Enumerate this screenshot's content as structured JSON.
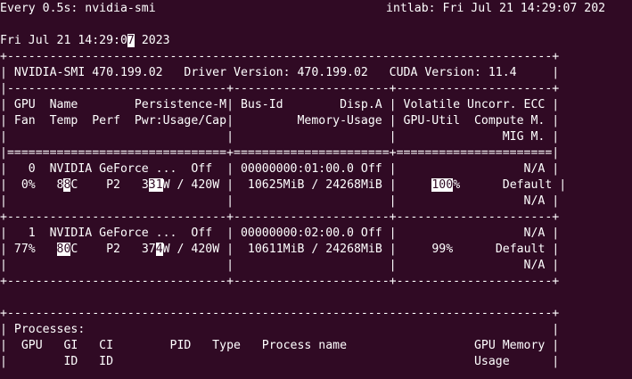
{
  "watch_header": {
    "command": "Every 0.5s: nvidia-smi",
    "host_time": "intlab: Fri Jul 21 14:29:07 202"
  },
  "date_line": {
    "before_cursor": "Fri Jul 21 14:29:0",
    "cursor_char": "7",
    "after_cursor": " 2023"
  },
  "smi_table": {
    "border_top": "+-----------------------------------------------------------------------------+",
    "version_row": "| NVIDIA-SMI 470.199.02   Driver Version: 470.199.02   CUDA Version: 11.4     |",
    "section_sep": "|-------------------------------+----------------------+----------------------+",
    "header_row_1": "| GPU  Name        Persistence-M| Bus-Id        Disp.A | Volatile Uncorr. ECC |",
    "header_row_2": "| Fan  Temp  Perf  Pwr:Usage/Cap|         Memory-Usage | GPU-Util  Compute M. |",
    "header_row_3": "|                               |                      |               MIG M. |",
    "header_sep": "|===============================+======================+======================|",
    "gpu_sep": "+-------------------------------+----------------------+----------------------+",
    "gpus": [
      {
        "row1": "|   0  NVIDIA GeForce ...  Off  | 00000000:01:00.0 Off |                  N/A |",
        "row2_a": "|  0%   8",
        "row2_b": "8",
        "row2_c": "C    P2   3",
        "row2_d": "31",
        "row2_e": "W / 420W |  10625MiB / 24268MiB |     ",
        "row2_f": "100",
        "row2_g": "%      Default |",
        "row3": "|                               |                      |                  N/A |"
      },
      {
        "row1": "|   1  NVIDIA GeForce ...  Off  | 00000000:02:00.0 Off |                  N/A |",
        "row2_a": "| 77%   ",
        "row2_b": "80",
        "row2_c": "C    P2   37",
        "row2_d": "4",
        "row2_e": "W / 420W |  10611MiB / 24268MiB |     99%      Default |",
        "row3": "|                               |                      |                  N/A |"
      }
    ]
  },
  "processes_table": {
    "border_top": "+-----------------------------------------------------------------------------+",
    "title_row": "| Processes:                                                                  |",
    "header_row_1": "|  GPU   GI   CI        PID   Type   Process name                  GPU Memory |",
    "header_row_2": "|        ID   ID                                                   Usage      |"
  }
}
